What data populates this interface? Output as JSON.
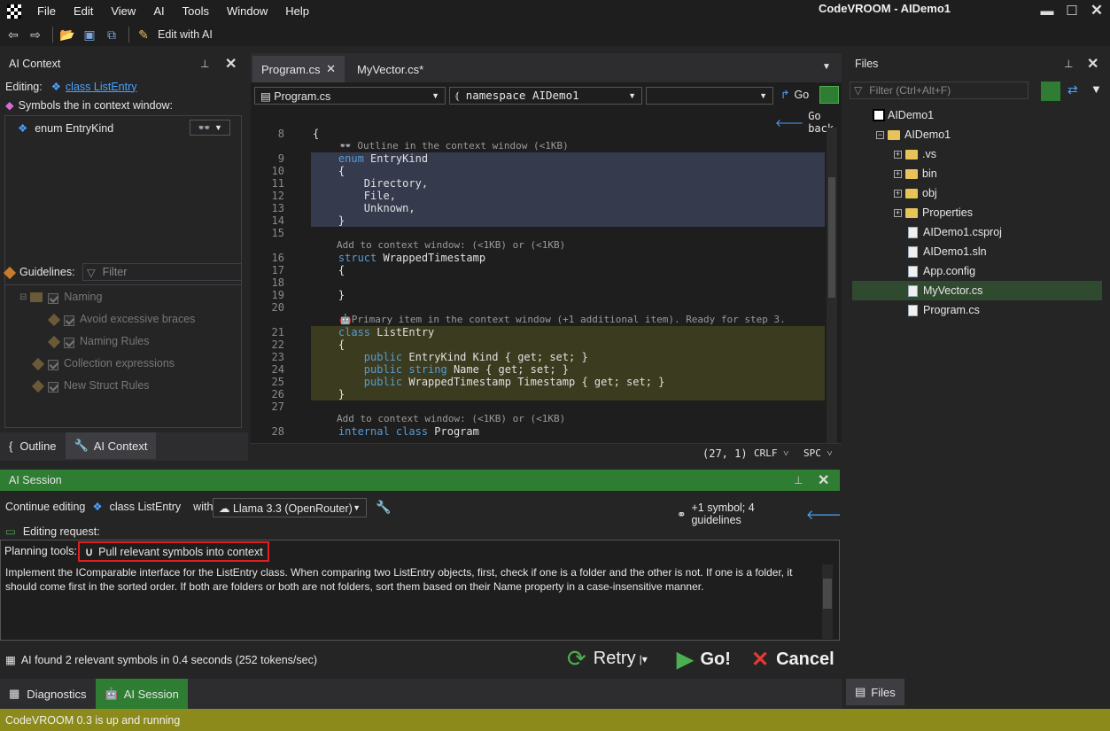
{
  "app": {
    "title": "CodeVROOM - AIDemo1",
    "status": "CodeVROOM 0.3 is up and running"
  },
  "menu": [
    "File",
    "Edit",
    "View",
    "AI",
    "Tools",
    "Window",
    "Help"
  ],
  "toolbar": {
    "edit_with_ai": "Edit with AI"
  },
  "ai_context": {
    "title": "AI Context",
    "editing_label": "Editing:",
    "editing_target": "class ListEntry",
    "symbols_label": "Symbols the in context window:",
    "symbols": [
      {
        "name": "enum EntryKind"
      }
    ],
    "guidelines_label": "Guidelines:",
    "filter_placeholder": "Filter",
    "guidelines": [
      {
        "label": "Naming"
      },
      {
        "label": "Avoid excessive braces"
      },
      {
        "label": "Naming Rules"
      },
      {
        "label": "Collection expressions"
      },
      {
        "label": "New Struct Rules"
      }
    ],
    "tabs": [
      "Outline",
      "AI Context"
    ]
  },
  "editor": {
    "tabs": [
      "Program.cs",
      "MyVector.cs*"
    ],
    "file_combo": "Program.cs",
    "namespace_combo": "namespace AIDemo1",
    "member_combo": "",
    "go_label": "Go",
    "go_back_label": "Go back",
    "cursor_pos": "(27, 1)",
    "line_ending": "CRLF",
    "indent": "SPC",
    "hints": {
      "outline": "Outline in the context window (<1KB)",
      "add1": "Add to context window:  (<1KB) or  (<1KB)",
      "primary": "Primary item in the context window (+1 additional item). Ready for step 3.",
      "add2": "Add to context window:  (<1KB) or  (<1KB)"
    },
    "lines": [
      {
        "n": "8",
        "t": "{"
      },
      {
        "n": "9",
        "t": "    enum EntryKind"
      },
      {
        "n": "10",
        "t": "    {"
      },
      {
        "n": "11",
        "t": "        Directory,"
      },
      {
        "n": "12",
        "t": "        File,"
      },
      {
        "n": "13",
        "t": "        Unknown,"
      },
      {
        "n": "14",
        "t": "    }"
      },
      {
        "n": "15",
        "t": ""
      },
      {
        "n": "16",
        "t": "    struct WrappedTimestamp"
      },
      {
        "n": "17",
        "t": "    {"
      },
      {
        "n": "18",
        "t": ""
      },
      {
        "n": "19",
        "t": "    }"
      },
      {
        "n": "20",
        "t": ""
      },
      {
        "n": "21",
        "t": "    class ListEntry"
      },
      {
        "n": "22",
        "t": "    {"
      },
      {
        "n": "23",
        "t": "        public EntryKind Kind { get; set; }"
      },
      {
        "n": "24",
        "t": "        public string Name { get; set; }"
      },
      {
        "n": "25",
        "t": "        public WrappedTimestamp Timestamp { get; set; }"
      },
      {
        "n": "26",
        "t": "    }"
      },
      {
        "n": "27",
        "t": ""
      },
      {
        "n": "28",
        "t": "    internal class Program"
      }
    ]
  },
  "files": {
    "title": "Files",
    "filter_placeholder": "Filter (Ctrl+Alt+F)",
    "tree": [
      "AIDemo1",
      "AIDemo1",
      ".vs",
      "bin",
      "obj",
      "Properties",
      "AIDemo1.csproj",
      "AIDemo1.sln",
      "App.config",
      "MyVector.cs",
      "Program.cs"
    ],
    "tab": "Files"
  },
  "session": {
    "title": "AI Session",
    "continue_label": "Continue editing",
    "target": "class ListEntry",
    "with_label": "with",
    "model": "Llama 3.3 (OpenRouter)",
    "summary": "+1 symbol; 4 guidelines",
    "request_label": "Editing request:",
    "planning_label": "Planning tools:",
    "pull_button": "Pull relevant symbols into context",
    "request_text": "Implement the IComparable interface for the ListEntry class. When comparing two ListEntry objects, first, check if one is a folder and the other is not. If one is a folder, it should come first in the sorted order. If both are folders or both are not folders, sort them based on their Name property in a case-insensitive manner.",
    "result": "AI found 2 relevant symbols in 0.4 seconds (252 tokens/sec)",
    "retry": "Retry",
    "go": "Go!",
    "cancel": "Cancel",
    "tabs": [
      "Diagnostics",
      "AI Session"
    ]
  }
}
